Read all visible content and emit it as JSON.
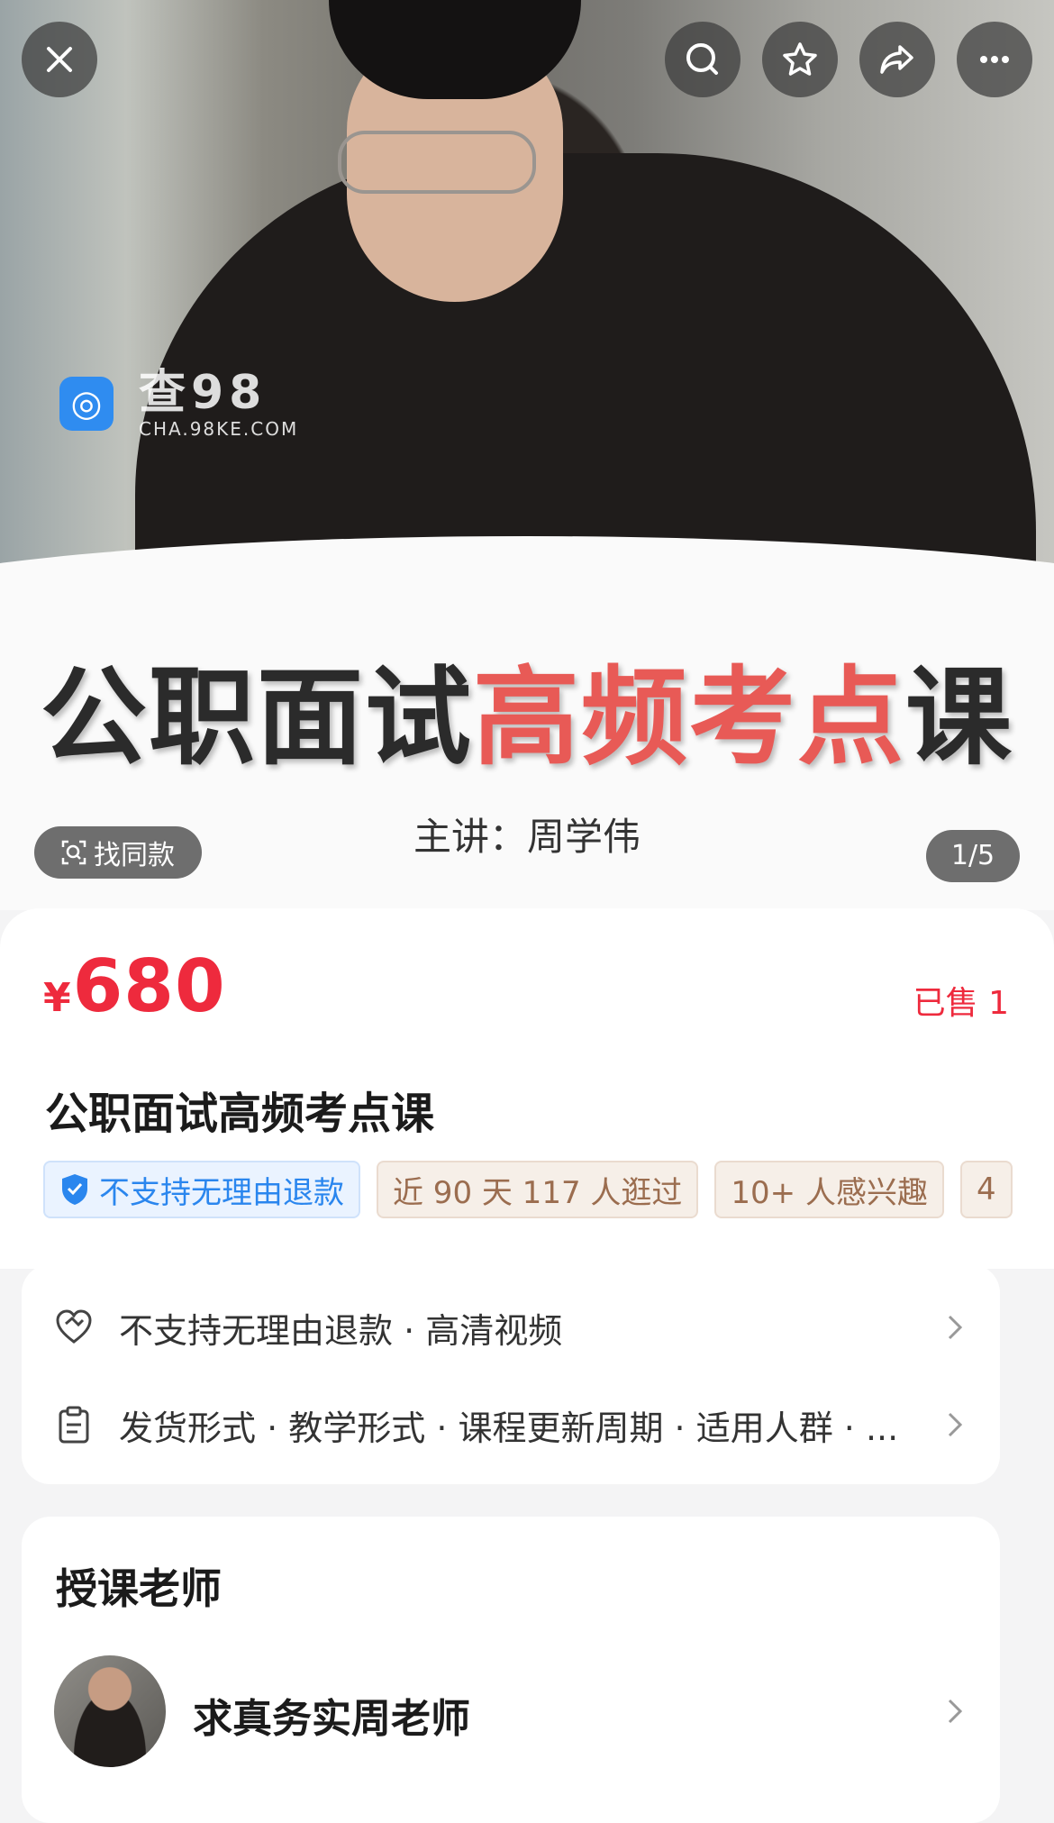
{
  "hero": {
    "watermark_big": "查98",
    "watermark_small": "CHA.98KE.COM",
    "cover_title_dark": "公职面试",
    "cover_title_red": "高频考点",
    "cover_title_end": "课",
    "cover_subtitle": "主讲：周学伟",
    "find_similar_label": "找同款",
    "pager": "1/5"
  },
  "top_actions": [
    "close-icon",
    "search-icon",
    "star-icon",
    "share-icon",
    "more-icon"
  ],
  "product": {
    "currency": "¥",
    "price": "680",
    "sold": "已售 1",
    "title": "公职面试高频考点课",
    "tags": [
      {
        "label": "不支持无理由退款",
        "style": "blue"
      },
      {
        "label": "近 90 天 117 人逛过",
        "style": "brown"
      },
      {
        "label": "10+ 人感兴趣",
        "style": "brown"
      },
      {
        "label": "4",
        "style": "brown"
      }
    ]
  },
  "info": {
    "row1": "不支持无理由退款 · 高清视频",
    "row2": "发货形式 · 教学形式 · 课程更新周期 · 适用人群 · ..."
  },
  "teacher": {
    "heading": "授课老师",
    "name": "求真务实周老师"
  },
  "colors": {
    "price_red": "#ee2a3d",
    "title_red": "#e85a56",
    "tag_blue": "#2a86ee",
    "tag_brown": "#9b6d4f"
  }
}
